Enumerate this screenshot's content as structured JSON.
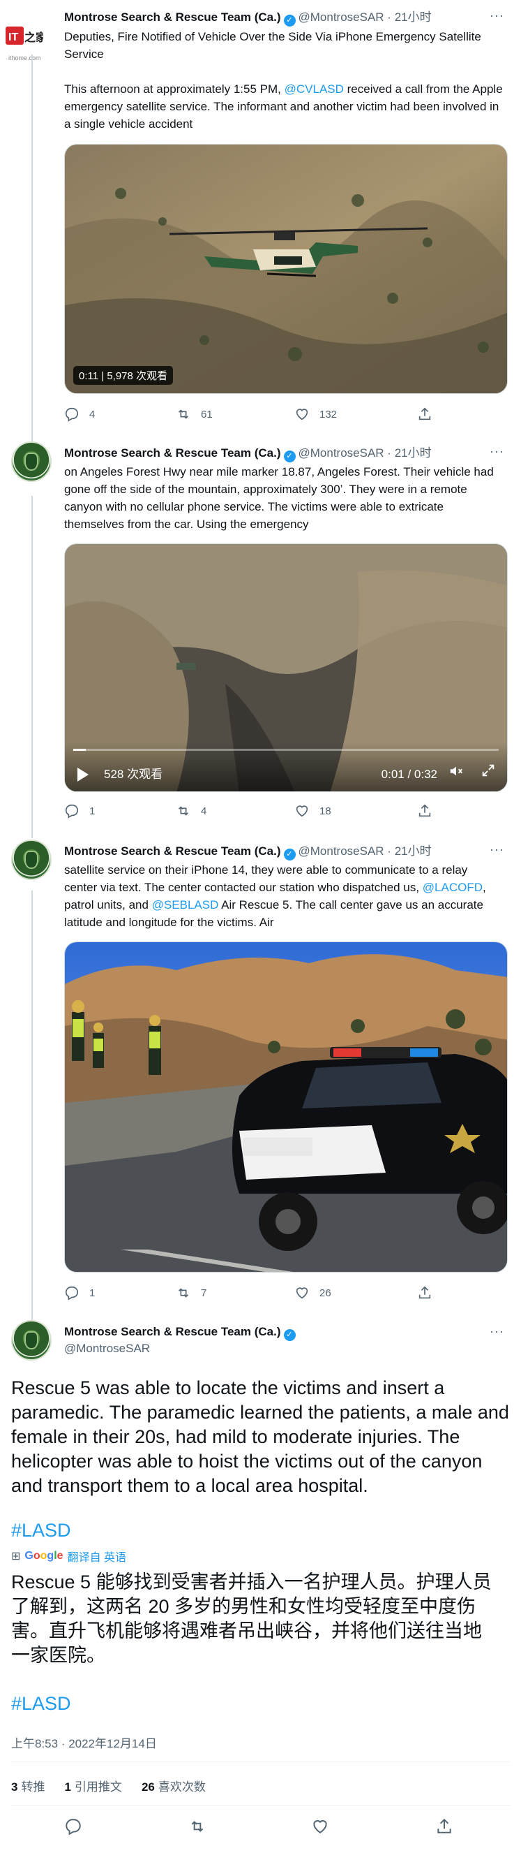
{
  "watermark": {
    "brand": "IT之家",
    "site": "ithome.com"
  },
  "author": {
    "name": "Montrose Search & Rescue Team (Ca.)",
    "handle": "@MontroseSAR",
    "verified_mark": "✓"
  },
  "tweets": [
    {
      "time": "21小时",
      "text_pre": "Deputies, Fire Notified of Vehicle Over the Side Via iPhone Emergency Satellite Service",
      "text_p2a": "This afternoon at approximately 1:55 PM,",
      "mention1": "@CVLASD",
      "text_p2b": " received a call from the Apple emergency satellite service. The informant and another victim had been involved in a single vehicle accident",
      "media": {
        "time": "0:11",
        "views": "5,978 次观看"
      },
      "stats": {
        "replies": "4",
        "retweets": "61",
        "likes": "132"
      }
    },
    {
      "time": "21小时",
      "text": "on Angeles Forest Hwy near mile marker 18.87, Angeles Forest. Their vehicle had gone off the side of the mountain, approximately 300’.  They were in a remote canyon with no cellular phone service. The victims were able to extricate themselves from the car. Using the emergency",
      "media": {
        "views": "528 次观看",
        "progress": "0:01 / 0:32"
      },
      "stats": {
        "replies": "1",
        "retweets": "4",
        "likes": "18"
      }
    },
    {
      "time": "21小时",
      "text_a": "satellite service on their iPhone 14, they were able to communicate to a relay center via text. The center contacted our station who dispatched us, ",
      "mention1": "@LACOFD",
      "text_b": ", patrol units, and ",
      "mention2": "@SEBLASD",
      "text_c": " Air Rescue 5. The call center gave us an accurate latitude and longitude for the victims. Air",
      "stats": {
        "replies": "1",
        "retweets": "7",
        "likes": "26"
      }
    }
  ],
  "main_tweet": {
    "text": "Rescue 5 was able to locate the victims and insert a paramedic. The paramedic learned the patients, a male and female in their 20s, had mild to moderate injuries. The helicopter was able to hoist the victims out of the canyon and transport them to a local area hospital.",
    "hashtag": "#LASD",
    "translated_by": "翻译自 英语",
    "translation": "Rescue 5 能够找到受害者并插入一名护理人员。护理人员了解到，这两名 20 多岁的男性和女性均受轻度至中度伤害。直升飞机能够将遇难者吊出峡谷，并将他们送往当地一家医院。",
    "hashtag2": "#LASD",
    "timestamp": "上午8:53 · 2022年12月14日",
    "retweets": "3",
    "retweets_label": "转推",
    "quotes": "1",
    "quotes_label": "引用推文",
    "likes": "26",
    "likes_label": "喜欢次数"
  },
  "colors": {
    "accent": "#1d9bf0",
    "text": "#0f1419",
    "muted": "#536471"
  }
}
